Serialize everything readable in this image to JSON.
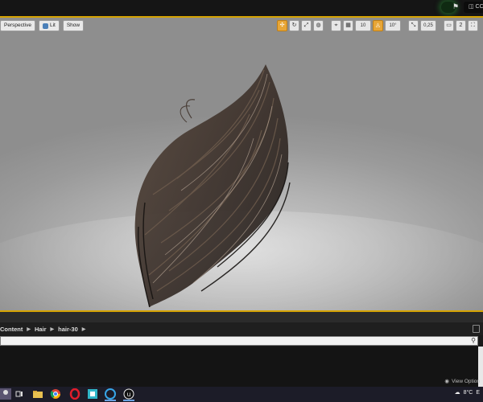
{
  "viewport": {
    "perspective_label": "Perspective",
    "lit_label": "Lit",
    "show_label": "Show",
    "grid_snap_value": "10",
    "rotation_snap_value": "10°",
    "scale_snap_value": "0,25",
    "camera_speed_value": "2"
  },
  "content_browser": {
    "breadcrumbs": [
      "Content",
      "Hair",
      "hair-30"
    ],
    "search_placeholder": "",
    "view_options_label": "View Option"
  },
  "taskbar": {
    "temperature": "8°C",
    "tray_text": "E"
  },
  "colors": {
    "viewport_border": "#d5a300",
    "active_tool": "#e8a637"
  }
}
